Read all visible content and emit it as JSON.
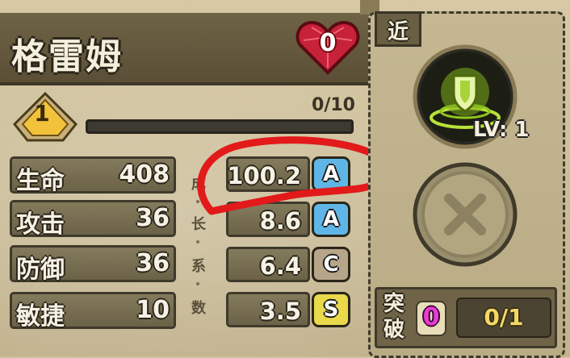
{
  "hero": {
    "name": "格雷姆",
    "heart_count": "0"
  },
  "level": {
    "value": "1",
    "exp_text": "0/10",
    "exp_fraction": 0
  },
  "stats": [
    {
      "label": "生命",
      "value": "408",
      "growth": "100.2",
      "grade": "A"
    },
    {
      "label": "攻击",
      "value": "36",
      "growth": "8.6",
      "grade": "A"
    },
    {
      "label": "防御",
      "value": "36",
      "growth": "6.4",
      "grade": "C"
    },
    {
      "label": "敏捷",
      "value": "10",
      "growth": "3.5",
      "grade": "S"
    }
  ],
  "growth_label_chars": [
    "成",
    "长",
    "系",
    "数"
  ],
  "skill_panel": {
    "tab_label": "近",
    "skill_level_text": "LV: 1",
    "breakthrough_label": "突破",
    "breakthrough_count": "0",
    "breakthrough_progress": "0/1"
  },
  "colors": {
    "grade_A": "#5fb6e6",
    "grade_C": "#b7a58a",
    "grade_S": "#e9d94b",
    "annotation": "#e21a1a",
    "heart": "#d8283c"
  },
  "icons": {
    "heart": "heart-gem-icon",
    "level": "level-diamond-icon",
    "skill": "shield-skill-icon",
    "empty": "x-icon"
  }
}
